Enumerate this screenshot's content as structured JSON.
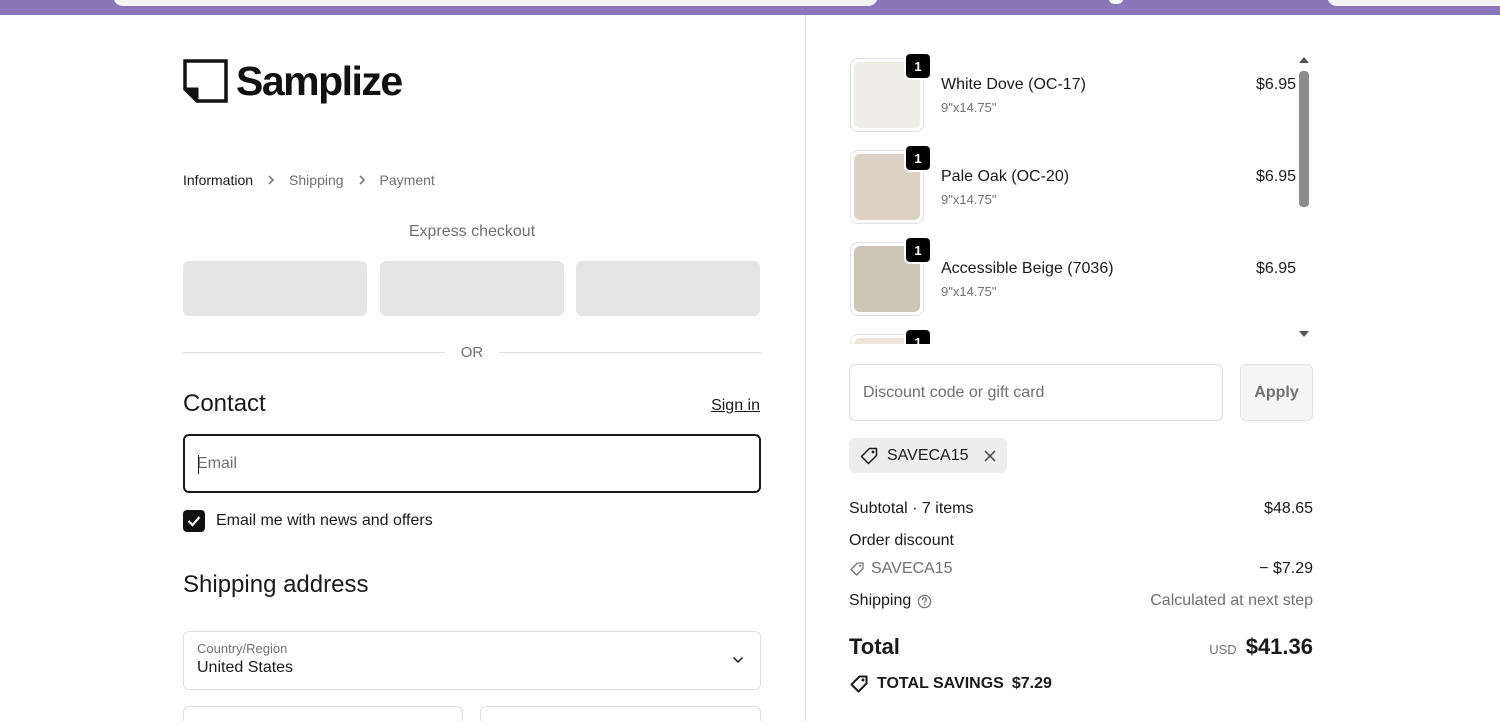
{
  "brand": {
    "name": "Samplize"
  },
  "breadcrumb": [
    {
      "label": "Information"
    },
    {
      "label": "Shipping"
    },
    {
      "label": "Payment"
    }
  ],
  "express": {
    "label": "Express checkout",
    "or_label": "OR"
  },
  "contact": {
    "heading": "Contact",
    "sign_in": "Sign in",
    "email_placeholder": "Email",
    "newsletter_label": "Email me with news and offers",
    "newsletter_checked": true
  },
  "shipping_address": {
    "heading": "Shipping address",
    "country_label": "Country/Region",
    "country_value": "United States"
  },
  "cart": {
    "items": [
      {
        "qty": "1",
        "name": "White Dove (OC-17)",
        "size": "9\"x14.75\"",
        "price": "$6.95",
        "swatch": "#f0eee4"
      },
      {
        "qty": "1",
        "name": "Pale Oak (OC-20)",
        "size": "9\"x14.75\"",
        "price": "$6.95",
        "swatch": "#dcd1c4"
      },
      {
        "qty": "1",
        "name": "Accessible Beige (7036)",
        "size": "9\"x14.75\"",
        "price": "$6.95",
        "swatch": "#cfc5b7"
      },
      {
        "qty": "1",
        "name": "",
        "size": "",
        "price": "",
        "swatch": "#ece6db"
      }
    ]
  },
  "discount": {
    "placeholder": "Discount code or gift card",
    "apply_label": "Apply",
    "applied_code": "SAVECA15"
  },
  "summary": {
    "subtotal_label": "Subtotal · 7 items",
    "subtotal_value": "$48.65",
    "order_discount_label": "Order discount",
    "discount_code": "SAVECA15",
    "discount_value": "− $7.29",
    "shipping_label": "Shipping",
    "shipping_value": "Calculated at next step",
    "total_label": "Total",
    "currency": "USD",
    "total_value": "$41.36",
    "savings_label": "TOTAL SAVINGS",
    "savings_value": "$7.29"
  },
  "colors": {
    "topbar": "#8a76b8",
    "checkbox": "#111111",
    "placeholder_gray": "#e5e5e5"
  }
}
